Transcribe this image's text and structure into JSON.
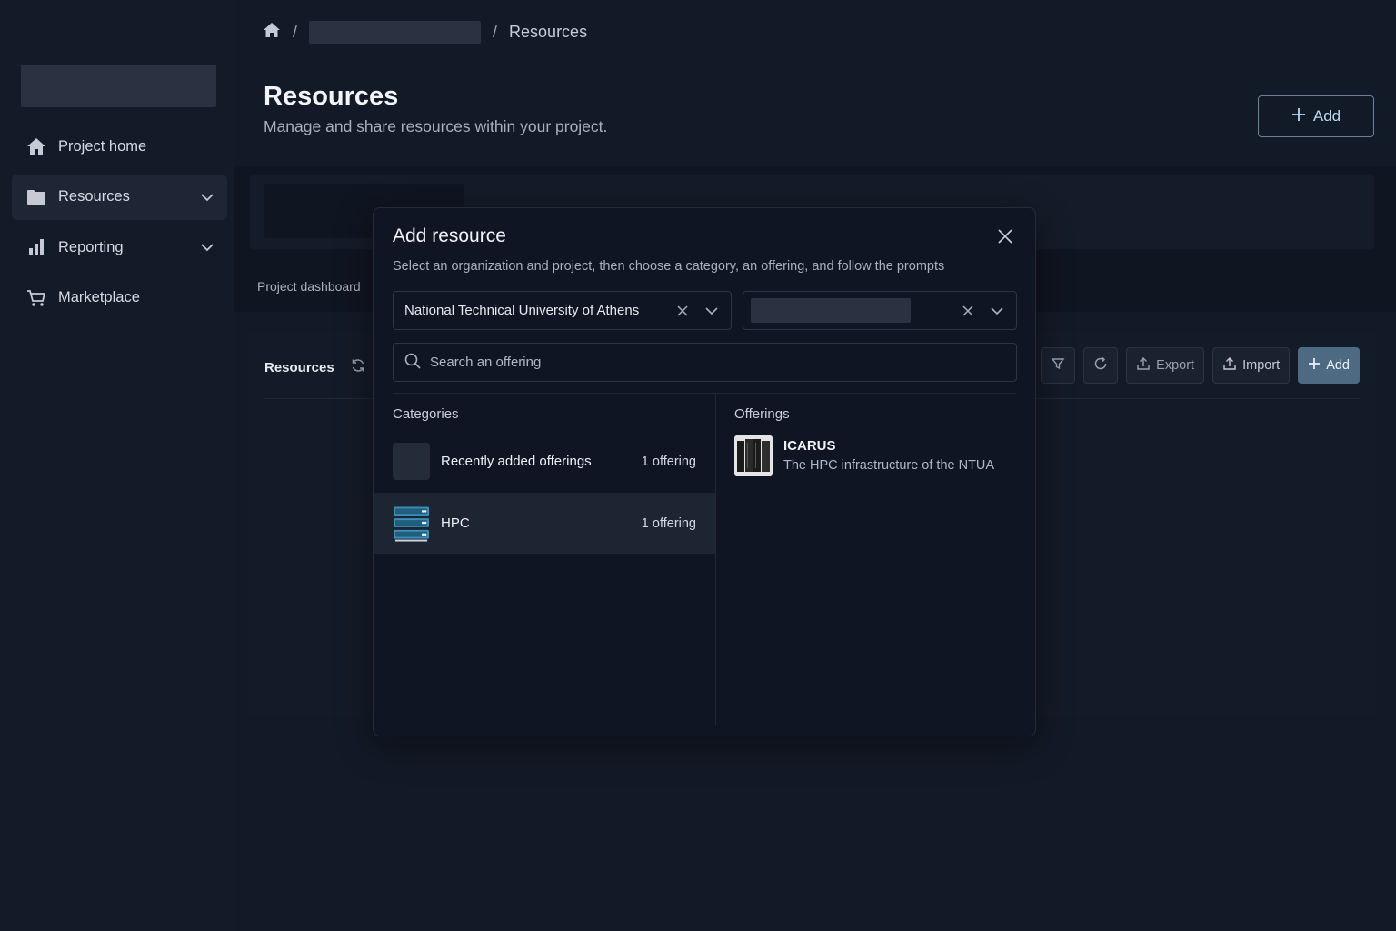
{
  "sidebar": {
    "items": [
      {
        "label": "Project home",
        "icon": "home-icon"
      },
      {
        "label": "Resources",
        "icon": "folder-icon"
      },
      {
        "label": "Reporting",
        "icon": "bar-chart-icon"
      },
      {
        "label": "Marketplace",
        "icon": "cart-icon"
      }
    ]
  },
  "breadcrumb": {
    "separator": "/",
    "current": "Resources"
  },
  "page": {
    "title": "Resources",
    "subtitle": "Manage and share resources within your project.",
    "add_label": "Add"
  },
  "tabs": {
    "dashboard": "Project dashboard"
  },
  "panel": {
    "title": "Resources",
    "export_label": "Export",
    "import_label": "Import",
    "add_label": "Add"
  },
  "modal": {
    "title": "Add resource",
    "description": "Select an organization and project, then choose a category, an offering, and follow the prompts",
    "organization": "National Technical University of Athens",
    "search_placeholder": "Search an offering",
    "categories_heading": "Categories",
    "offerings_heading": "Offerings",
    "categories": [
      {
        "name": "Recently added offerings",
        "count": "1 offering"
      },
      {
        "name": "HPC",
        "count": "1 offering"
      }
    ],
    "offerings": [
      {
        "name": "ICARUS",
        "description": "The HPC infrastructure of the NTUA"
      }
    ]
  },
  "colors": {
    "background": "#131a27",
    "sidebar": "#141b28",
    "accent": "#4d6a82",
    "accent_outline": "#6c8397"
  }
}
